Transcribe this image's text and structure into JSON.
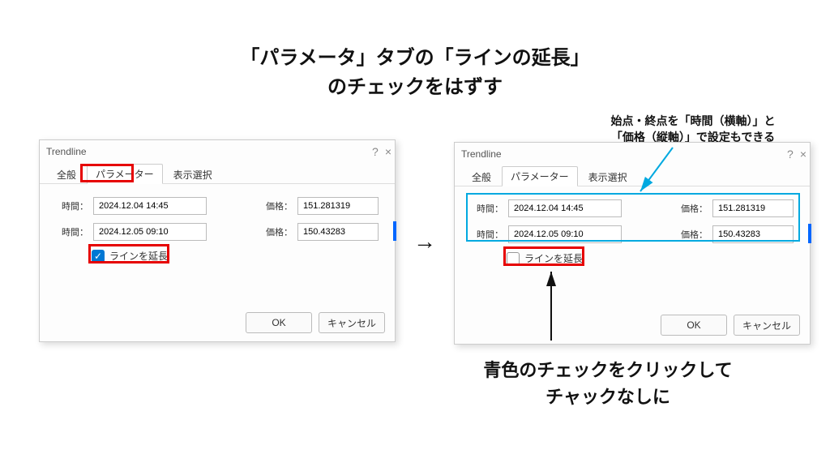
{
  "title_line1": "「パラメータ」タブの「ラインの延長」",
  "title_line2": "のチェックをはずす",
  "side_note_line1": "始点・終点を「時間（横軸）」と",
  "side_note_line2": "「価格（縦軸）」で設定もできる",
  "arrow_mid": "→",
  "bottom_line1": "青色のチェックをクリックして",
  "bottom_line2": "チャックなしに",
  "dialog": {
    "title": "Trendline",
    "help_glyph": "?",
    "close_glyph": "×",
    "tabs": {
      "general": "全般",
      "parameters": "パラメーター",
      "display": "表示選択"
    },
    "labels": {
      "time": "時間：",
      "price": "価格：",
      "extend": "ラインを延長"
    },
    "row1": {
      "time": "2024.12.04 14:45",
      "price": "151.281319"
    },
    "row2": {
      "time": "2024.12.05 09:10",
      "price": "150.43283"
    },
    "buttons": {
      "ok": "OK",
      "cancel": "キャンセル"
    },
    "checkmark": "✓"
  }
}
